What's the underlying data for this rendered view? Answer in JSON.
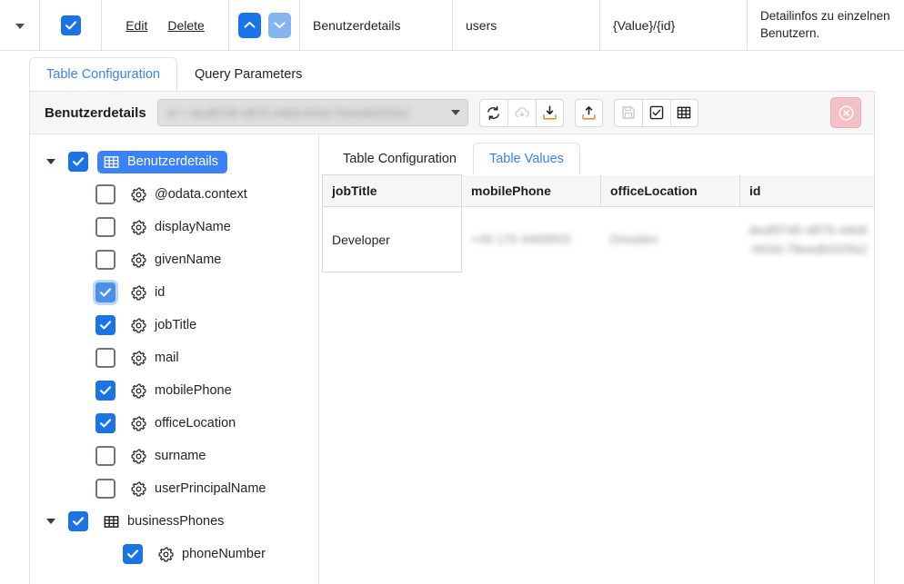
{
  "topbar": {
    "caret_icon": "chevron-down-icon",
    "row_checkbox_checked": true,
    "edit_label": "Edit",
    "delete_label": "Delete",
    "move_up_icon": "chevron-up-icon",
    "move_down_icon": "chevron-down-icon",
    "name": "Benutzerdetails",
    "source": "users",
    "path": "{Value}/{id}",
    "description": "Detailinfos zu einzelnen Benutzern."
  },
  "tabs": [
    {
      "label": "Table Configuration",
      "active": true
    },
    {
      "label": "Query Parameters",
      "active": false
    }
  ],
  "panel": {
    "title": "Benutzerdetails",
    "select_value": "id = deaf97d0-d876-44b8-843d-79eedb020fa2",
    "select_arrow_icon": "chevron-down-icon",
    "toolbar": [
      {
        "name": "refresh-icon",
        "disabled": false
      },
      {
        "name": "cloud-download-icon",
        "disabled": true
      },
      {
        "name": "import-icon",
        "disabled": false
      },
      {
        "name": "export-icon",
        "disabled": false
      },
      {
        "name": "save-icon",
        "disabled": true
      },
      {
        "name": "checkbox-icon",
        "disabled": false
      },
      {
        "name": "table-grid-icon",
        "disabled": false
      }
    ],
    "delete_icon": "circle-x-icon"
  },
  "tree": [
    {
      "label": "Benutzerdetails",
      "icon": "table-grid-icon",
      "checked": true,
      "focus": false,
      "expandable": true,
      "indent": 0,
      "selected": true
    },
    {
      "label": "@odata.context",
      "icon": "gear-icon",
      "checked": false,
      "focus": false,
      "expandable": false,
      "indent": 1,
      "selected": false
    },
    {
      "label": "displayName",
      "icon": "gear-icon",
      "checked": false,
      "focus": false,
      "expandable": false,
      "indent": 1,
      "selected": false
    },
    {
      "label": "givenName",
      "icon": "gear-icon",
      "checked": false,
      "focus": false,
      "expandable": false,
      "indent": 1,
      "selected": false
    },
    {
      "label": "id",
      "icon": "gear-icon",
      "checked": true,
      "focus": true,
      "expandable": false,
      "indent": 1,
      "selected": false
    },
    {
      "label": "jobTitle",
      "icon": "gear-icon",
      "checked": true,
      "focus": false,
      "expandable": false,
      "indent": 1,
      "selected": false
    },
    {
      "label": "mail",
      "icon": "gear-icon",
      "checked": false,
      "focus": false,
      "expandable": false,
      "indent": 1,
      "selected": false
    },
    {
      "label": "mobilePhone",
      "icon": "gear-icon",
      "checked": true,
      "focus": false,
      "expandable": false,
      "indent": 1,
      "selected": false
    },
    {
      "label": "officeLocation",
      "icon": "gear-icon",
      "checked": true,
      "focus": false,
      "expandable": false,
      "indent": 1,
      "selected": false
    },
    {
      "label": "surname",
      "icon": "gear-icon",
      "checked": false,
      "focus": false,
      "expandable": false,
      "indent": 1,
      "selected": false
    },
    {
      "label": "userPrincipalName",
      "icon": "gear-icon",
      "checked": false,
      "focus": false,
      "expandable": false,
      "indent": 1,
      "selected": false
    },
    {
      "label": "businessPhones",
      "icon": "table-grid-icon",
      "checked": true,
      "focus": false,
      "expandable": true,
      "indent": 0,
      "selected": false
    },
    {
      "label": "phoneNumber",
      "icon": "gear-icon",
      "checked": true,
      "focus": false,
      "expandable": false,
      "indent": 2,
      "selected": false
    }
  ],
  "subtabs": [
    {
      "label": "Table Configuration",
      "active": false
    },
    {
      "label": "Table Values",
      "active": true
    }
  ],
  "values_table": {
    "columns": [
      "jobTitle",
      "mobilePhone",
      "officeLocation",
      "id"
    ],
    "rows": [
      {
        "jobTitle": "Developer",
        "mobilePhone": "+49 170 4469503",
        "officeLocation": "Dresden",
        "id": "deaf97d0-d876-44b8-843d-79eedb020fa2",
        "redacted": [
          "mobilePhone",
          "officeLocation",
          "id"
        ]
      }
    ]
  },
  "colors": {
    "accent": "#1b73e8",
    "tab_active": "#3b82f6",
    "selected_row": "#3b82f6",
    "danger": "#f3c0c6",
    "border": "#dee2e6",
    "header_bg": "#f6f6f7"
  }
}
